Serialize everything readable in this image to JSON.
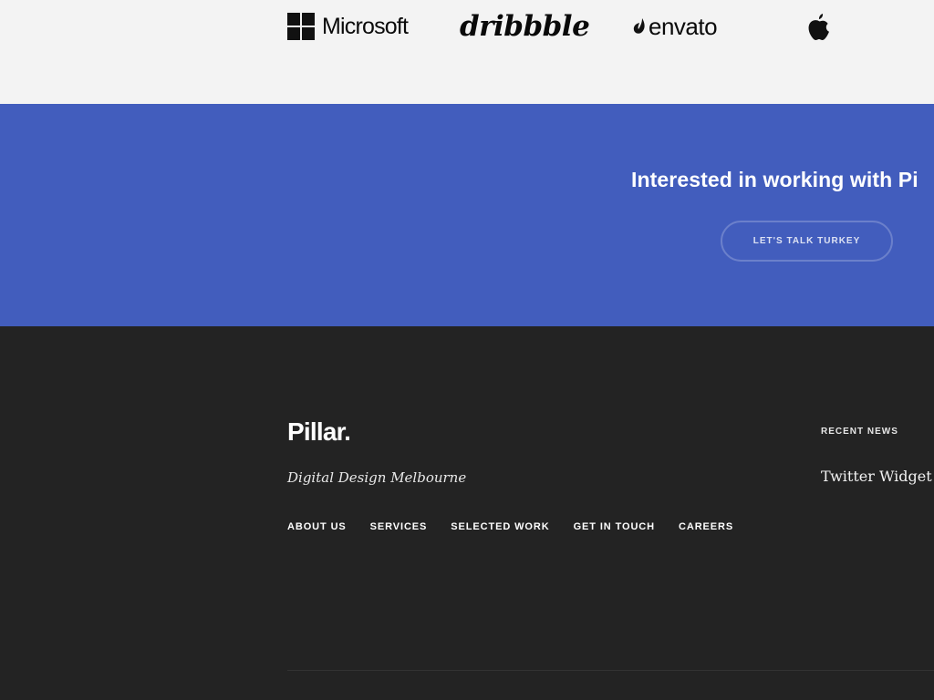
{
  "logos": [
    {
      "name": "Microsoft",
      "icon": "microsoft-windows-grid"
    },
    {
      "name": "dribbble",
      "icon": "dribbble-wordmark"
    },
    {
      "name": "envato",
      "icon": "envato-leaf"
    },
    {
      "name": "",
      "icon": "apple-logo"
    }
  ],
  "cta": {
    "heading": "Interested in working with Pi",
    "button_label": "LET'S TALK TURKEY",
    "background": "#425dbd"
  },
  "footer": {
    "brand": "Pillar.",
    "tagline": "Digital Design Melbourne",
    "nav": [
      "ABOUT US",
      "SERVICES",
      "SELECTED WORK",
      "GET IN TOUCH",
      "CAREERS"
    ],
    "news_heading": "RECENT NEWS",
    "twitter_widget": "Twitter Widget",
    "background": "#232323"
  }
}
